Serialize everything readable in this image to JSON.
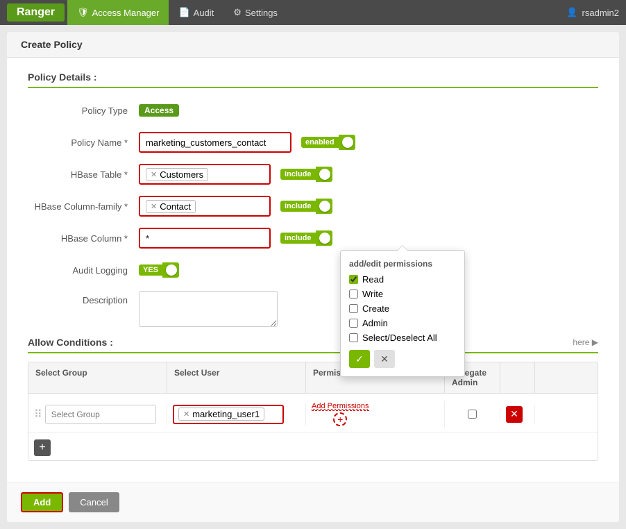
{
  "nav": {
    "brand": "Ranger",
    "items": [
      {
        "label": "Access Manager",
        "icon": "shield",
        "active": true
      },
      {
        "label": "Audit",
        "icon": "document",
        "active": false
      },
      {
        "label": "Settings",
        "icon": "gear",
        "active": false
      }
    ],
    "user": "rsadmin2"
  },
  "page": {
    "title": "Create Policy",
    "policy_details_label": "Policy Details :",
    "allow_conditions_label": "Allow Conditions :",
    "here_link": "here ▶"
  },
  "form": {
    "policy_type_label": "Policy Type",
    "policy_type_value": "Access",
    "policy_name_label": "Policy Name *",
    "policy_name_value": "marketing_customers_contact",
    "policy_name_enabled_label": "enabled",
    "hbase_table_label": "HBase Table *",
    "hbase_table_value": "Customers",
    "hbase_table_include_label": "include",
    "hbase_column_family_label": "HBase Column-family *",
    "hbase_column_family_value": "Contact",
    "hbase_column_family_include_label": "include",
    "hbase_column_label": "HBase Column *",
    "hbase_column_value": "*",
    "hbase_column_include_label": "include",
    "audit_logging_label": "Audit Logging",
    "audit_logging_value": "YES",
    "description_label": "Description"
  },
  "conditions": {
    "col_select_group": "Select Group",
    "col_select_user": "Select User",
    "col_permissions": "Permissions",
    "col_delegate_admin": "Delegate Admin",
    "col_action": "",
    "row": {
      "select_group_placeholder": "Select Group",
      "select_user_value": "marketing_user1",
      "permissions_label": "Add Permissions",
      "delegate_admin_checked": false
    }
  },
  "permissions_popup": {
    "title": "add/edit permissions",
    "options": [
      {
        "label": "Read",
        "checked": true
      },
      {
        "label": "Write",
        "checked": false
      },
      {
        "label": "Create",
        "checked": false
      },
      {
        "label": "Admin",
        "checked": false
      },
      {
        "label": "Select/Deselect All",
        "checked": false
      }
    ],
    "ok_label": "✓",
    "cancel_label": "✕"
  },
  "buttons": {
    "add": "Add",
    "cancel": "Cancel",
    "add_row": "+"
  }
}
